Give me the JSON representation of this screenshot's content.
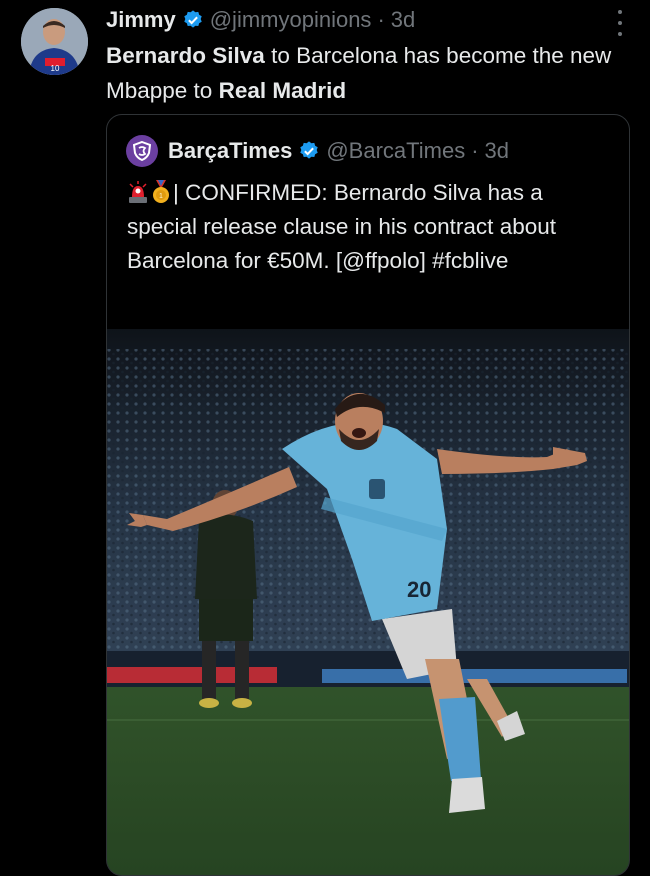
{
  "author": {
    "name": "Jimmy",
    "handle": "@jimmyopinions",
    "separator": "·",
    "time": "3d"
  },
  "tweet": {
    "part1": "Bernardo Silva",
    "part2": " to Barcelona has become the new Mbappe to ",
    "part3": "Real Madrid"
  },
  "quote": {
    "name": "BarçaTimes",
    "handle": "@BarcaTimes",
    "separator": "·",
    "time": "3d",
    "text": "| CONFIRMED: Bernardo Silva has a special release clause in his contract about Barcelona for €50M. [@ffpolo] #fcblive",
    "emojis": [
      "police-light-emoji",
      "gold-medal-emoji"
    ]
  },
  "colors": {
    "background": "#000000",
    "text": "#e7e9ea",
    "muted": "#71767b",
    "verified": "#1d9bf0",
    "border": "#2f3336"
  }
}
